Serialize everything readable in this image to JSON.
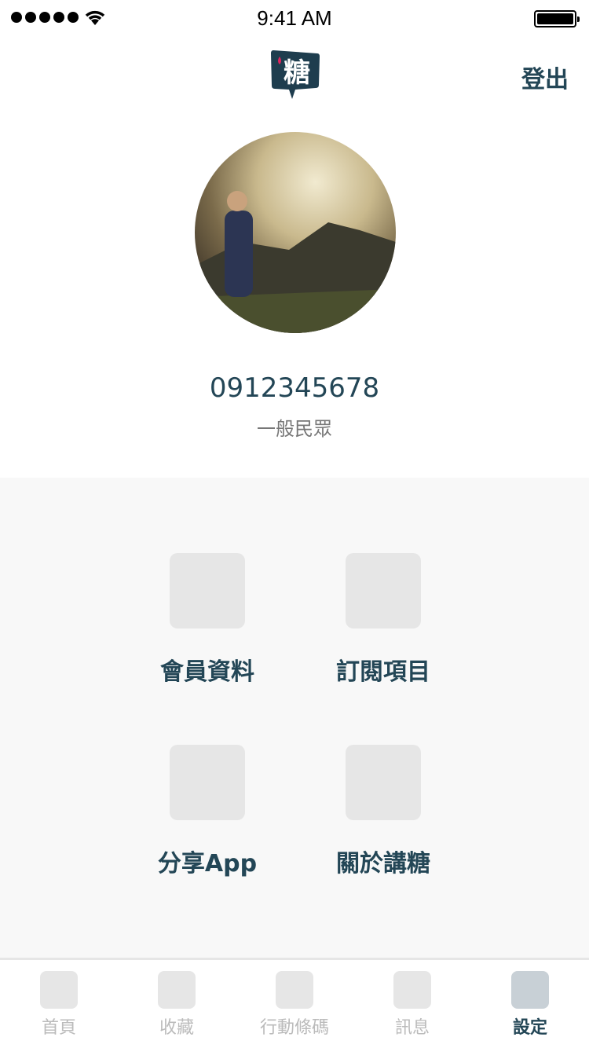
{
  "status": {
    "time": "9:41 AM"
  },
  "header": {
    "logo_text": "糖",
    "logout_label": "登出"
  },
  "profile": {
    "phone": "0912345678",
    "role": "一般民眾"
  },
  "menu": [
    {
      "label": "會員資料"
    },
    {
      "label": "訂閱項目"
    },
    {
      "label": "分享App"
    },
    {
      "label": "關於講糖"
    }
  ],
  "tabs": [
    {
      "label": "首頁"
    },
    {
      "label": "收藏"
    },
    {
      "label": "行動條碼"
    },
    {
      "label": "訊息"
    },
    {
      "label": "設定",
      "active": true
    }
  ],
  "colors": {
    "brand": "#234656",
    "accent": "#e0245e",
    "panel": "#f8f8f8"
  }
}
